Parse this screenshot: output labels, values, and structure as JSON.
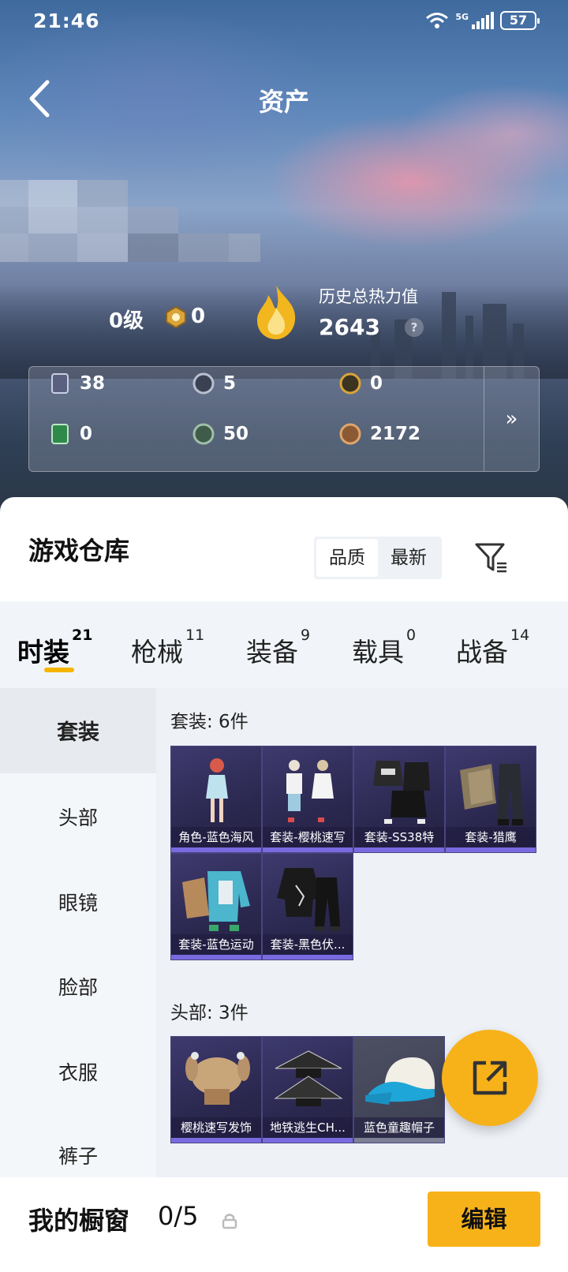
{
  "status_bar": {
    "time": "21:46",
    "network": "5G",
    "battery": "57"
  },
  "nav": {
    "title": "资产"
  },
  "profile": {
    "level": "0级",
    "medal_value": "0",
    "heat_label": "历史总热力值",
    "heat_value": "2643",
    "help_symbol": "?"
  },
  "resources": [
    {
      "icon": "card-icon",
      "value": "38"
    },
    {
      "icon": "silver-coin-icon",
      "value": "5"
    },
    {
      "icon": "gold-coin-icon",
      "value": "0"
    },
    {
      "icon": "green-ticket-icon",
      "value": "0"
    },
    {
      "icon": "green-coin-icon",
      "value": "50"
    },
    {
      "icon": "bronze-coin-icon",
      "value": "2172"
    }
  ],
  "resources_more": "»",
  "warehouse": {
    "title": "游戏仓库",
    "sort_options": [
      "品质",
      "最新"
    ],
    "active_sort": "品质"
  },
  "tabs": [
    {
      "label": "时装",
      "count": "21",
      "active": true
    },
    {
      "label": "枪械",
      "count": "11"
    },
    {
      "label": "装备",
      "count": "9"
    },
    {
      "label": "载具",
      "count": "0"
    },
    {
      "label": "战备",
      "count": "14"
    }
  ],
  "sidebar": [
    "套装",
    "头部",
    "眼镜",
    "脸部",
    "衣服",
    "裤子"
  ],
  "sections": [
    {
      "title": "套装: 6件",
      "items": [
        "角色-蓝色海风",
        "套装-樱桃速写",
        "套装-SS38特",
        "套装-猎鹰",
        "套装-蓝色运动",
        "套装-黑色伏..."
      ]
    },
    {
      "title": "头部: 3件",
      "items": [
        "樱桃速写发饰",
        "地铁逃生CH...",
        "蓝色童趣帽子"
      ]
    }
  ],
  "bottom_bar": {
    "label": "我的橱窗",
    "count": "0/5",
    "edit": "编辑"
  },
  "colors": {
    "accent": "#f7b21a",
    "tile_bg": "#2e2a58",
    "tile_bar": "#7a6ae0"
  }
}
